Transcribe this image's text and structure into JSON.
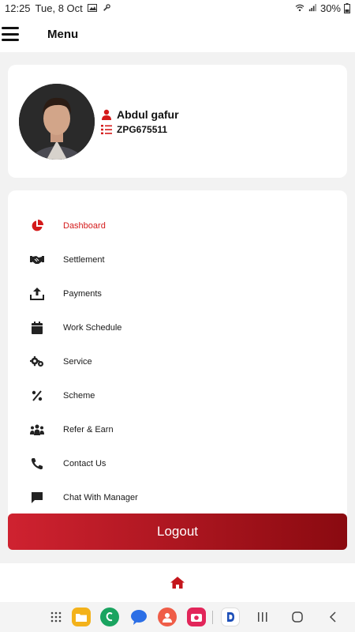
{
  "status_bar": {
    "time": "12:25",
    "date": "Tue, 8 Oct",
    "battery": "30%"
  },
  "app_bar": {
    "title": "Menu"
  },
  "profile": {
    "name": "Abdul gafur",
    "code": "ZPG675511"
  },
  "menu": {
    "items": [
      {
        "label": "Dashboard",
        "icon": "pie-chart-icon",
        "active": true
      },
      {
        "label": "Settlement",
        "icon": "handshake-icon"
      },
      {
        "label": "Payments",
        "icon": "upload-icon"
      },
      {
        "label": "Work Schedule",
        "icon": "calendar-icon"
      },
      {
        "label": "Service",
        "icon": "gears-icon"
      },
      {
        "label": "Scheme",
        "icon": "percent-icon"
      },
      {
        "label": "Refer & Earn",
        "icon": "people-icon"
      },
      {
        "label": "Contact Us",
        "icon": "phone-icon"
      },
      {
        "label": "Chat With Manager",
        "icon": "chat-icon"
      }
    ]
  },
  "logout": {
    "label": "Logout"
  },
  "colors": {
    "accent": "#d41a1a",
    "logout_start": "#cf2230",
    "logout_end": "#8a0a10"
  }
}
